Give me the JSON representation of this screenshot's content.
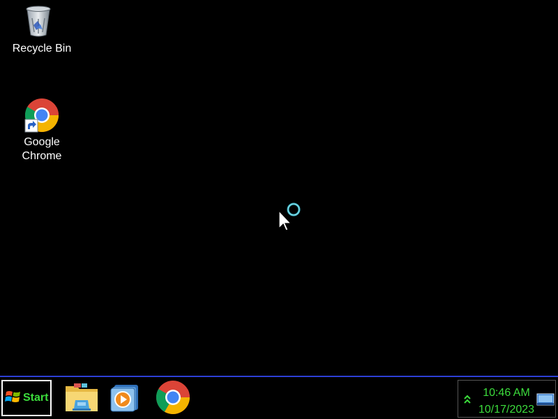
{
  "desktop": {
    "icons": [
      {
        "label": "Recycle Bin",
        "icon": "recycle-bin-icon"
      },
      {
        "label": "Google\nChrome",
        "icon": "chrome-icon"
      }
    ],
    "cursor": {
      "icon": "busy-cursor-icon"
    }
  },
  "taskbar": {
    "start_label": "Start",
    "start_icon": "windows-logo-icon",
    "pinned": [
      {
        "icon": "file-explorer-icon"
      },
      {
        "icon": "media-player-icon"
      },
      {
        "icon": "chrome-icon"
      }
    ],
    "tray": {
      "chevron_icon": "show-hidden-icons-icon",
      "time": "10:46 AM",
      "date": "10/17/2023",
      "show_desktop_icon": "show-desktop-icon"
    }
  },
  "colors": {
    "desktop_bg": "#000000",
    "taskbar_border": "#2d3fd6",
    "clock_text": "#3cdc3c",
    "start_text": "#3cdc3c"
  }
}
